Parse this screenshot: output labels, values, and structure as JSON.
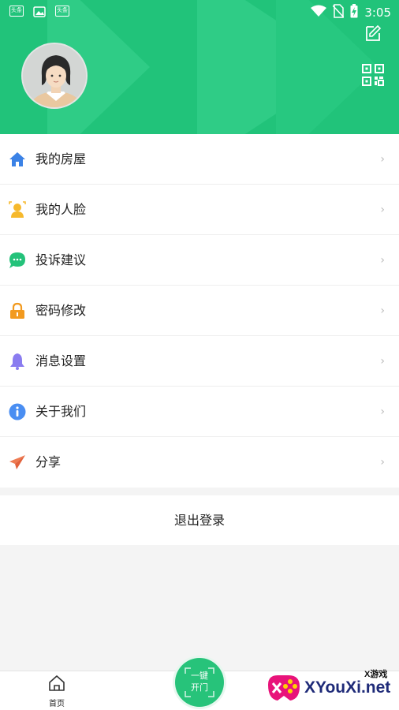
{
  "status_bar": {
    "app_icons": [
      "头条",
      "image-icon",
      "头条"
    ],
    "time": "3:05"
  },
  "header": {
    "bg_color": "#21c37a",
    "avatar": "avatar",
    "actions": [
      "edit-icon",
      "qr-code-icon"
    ]
  },
  "menu": {
    "items": [
      {
        "label": "我的房屋",
        "icon": "house-icon",
        "color": "#3b82e6"
      },
      {
        "label": "我的人脸",
        "icon": "face-icon",
        "color": "#f6b92d"
      },
      {
        "label": "投诉建议",
        "icon": "chat-icon",
        "color": "#24c27a"
      },
      {
        "label": "密码修改",
        "icon": "lock-icon",
        "color": "#f29a1f"
      },
      {
        "label": "消息设置",
        "icon": "bell-icon",
        "color": "#8a7cf0"
      },
      {
        "label": "关于我们",
        "icon": "info-icon",
        "color": "#4a8ef2"
      },
      {
        "label": "分享",
        "icon": "paper-plane-icon",
        "color": "#ee7b52"
      }
    ],
    "arrow": "›"
  },
  "logout": {
    "label": "退出登录"
  },
  "tabbar": {
    "home_label": "首页",
    "open_line1": "一键",
    "open_line2": "开门"
  },
  "watermark": {
    "brand": "XYouXi.net",
    "small": "X游戏"
  }
}
